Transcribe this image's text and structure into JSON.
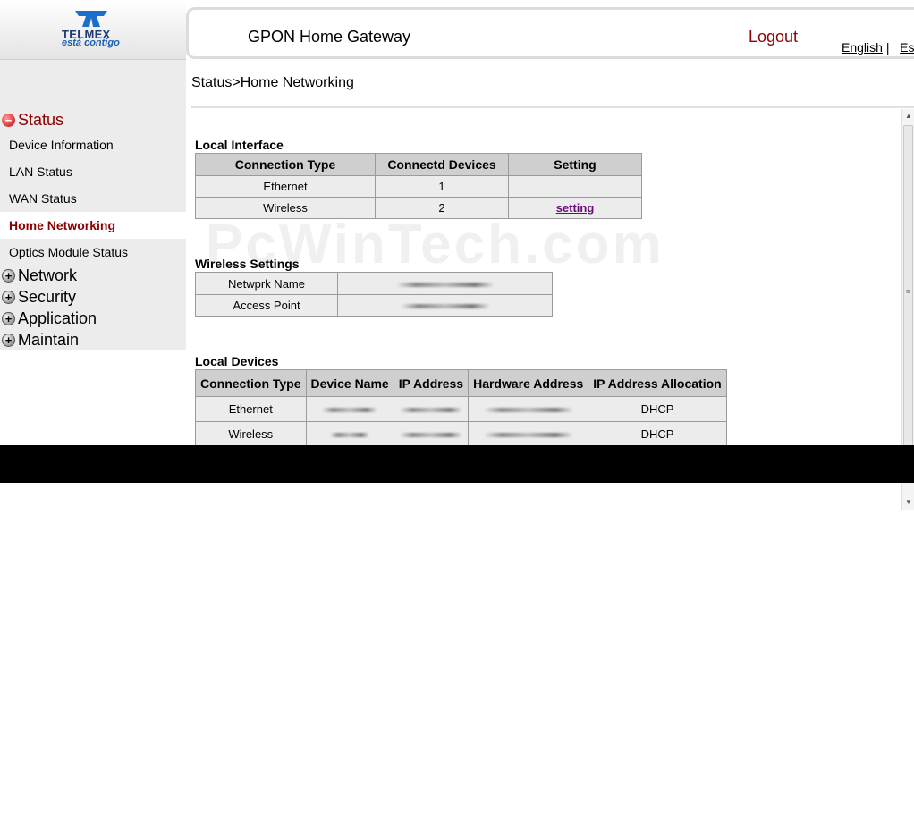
{
  "logo": {
    "brand": "TELMEX",
    "tagline": "está contigo"
  },
  "header": {
    "title": "GPON Home Gateway",
    "logout": "Logout",
    "lang_english": "English",
    "lang_sep": "|",
    "lang_es": "Es"
  },
  "breadcrumb": "Status>Home Networking",
  "sidebar": {
    "status": "Status",
    "items": [
      "Device Information",
      "LAN Status",
      "WAN Status",
      "Home Networking",
      "Optics Module Status"
    ],
    "groups": [
      "Network",
      "Security",
      "Application",
      "Maintain"
    ]
  },
  "local_interface": {
    "title": "Local Interface",
    "headers": [
      "Connection Type",
      "Connectd Devices",
      "Setting"
    ],
    "rows": [
      {
        "type": "Ethernet",
        "devices": "1",
        "setting": ""
      },
      {
        "type": "Wireless",
        "devices": "2",
        "setting": "setting"
      }
    ]
  },
  "wireless_settings": {
    "title": "Wireless Settings",
    "rows": [
      "Netwprk Name",
      "Access Point"
    ]
  },
  "local_devices": {
    "title": "Local Devices",
    "headers": [
      "Connection Type",
      "Device Name",
      "IP Address",
      "Hardware Address",
      "IP Address Allocation"
    ],
    "rows": [
      {
        "type": "Ethernet",
        "allocation": "DHCP"
      },
      {
        "type": "Wireless",
        "allocation": "DHCP"
      }
    ]
  },
  "watermark": "PcWinTech.com",
  "colors": {
    "accent": "#8b0000",
    "link": "#6a0a7a",
    "sidebar_bg": "#ececec",
    "header_cell": "#cfcfcf"
  }
}
